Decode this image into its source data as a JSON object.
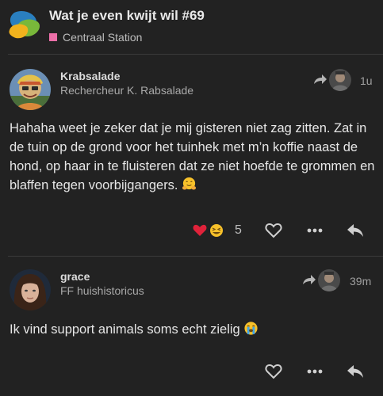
{
  "topic": {
    "title": "Wat je even kwijt wil #69",
    "category": "Centraal Station",
    "category_color": "#ec6fa8"
  },
  "posts": [
    {
      "username": "Krabsalade",
      "user_title": "Rechercheur K. Rabsalade",
      "time": "1u",
      "body": "Hahaha weet je zeker dat je mij gisteren niet zag zitten. Zat in de tuin op de grond voor het tuinhek met m’n koffie naast de hond, op haar in te fluisteren dat ze niet hoefde te grommen en blaffen tegen voorbijgangers.",
      "reaction_count": "5",
      "reactions": [
        "heart",
        "grinning-squint"
      ]
    },
    {
      "username": "grace",
      "user_title": "FF huishistoricus",
      "time": "39m",
      "body": "Ik vind support animals soms echt zielig"
    }
  ],
  "icons": {
    "like": "heart-outline-icon",
    "more": "ellipsis-icon",
    "reply": "reply-icon",
    "reply_to": "reply-to-arrow-icon"
  },
  "colors": {
    "background": "#222222",
    "heart": "#e0223a"
  }
}
